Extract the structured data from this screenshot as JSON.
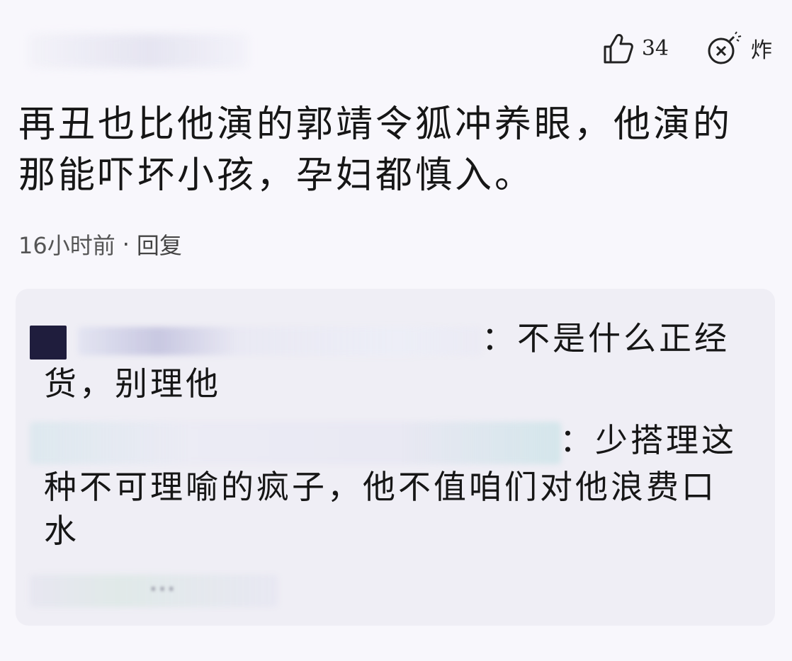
{
  "header": {
    "like_count": "34",
    "like_icon": "thumbs-up-icon",
    "bomb_icon": "bomb-icon",
    "bomb_label": "炸"
  },
  "comment": {
    "line1": "再丑也比他演的郭靖令狐冲养眼，他演的",
    "line2": "那能吓坏小孩，孕妇都慎入。",
    "time": "16小时前",
    "separator": "·",
    "reply_label": "回复"
  },
  "replies": [
    {
      "line1_suffix": "：不是什么正经",
      "line2": "货，别理他"
    },
    {
      "line1_suffix": "：少搭理这",
      "line2": "种不可理喻的疯子，他不值咱们对他浪费口",
      "line3": "水"
    }
  ],
  "more_replies_text": "···"
}
